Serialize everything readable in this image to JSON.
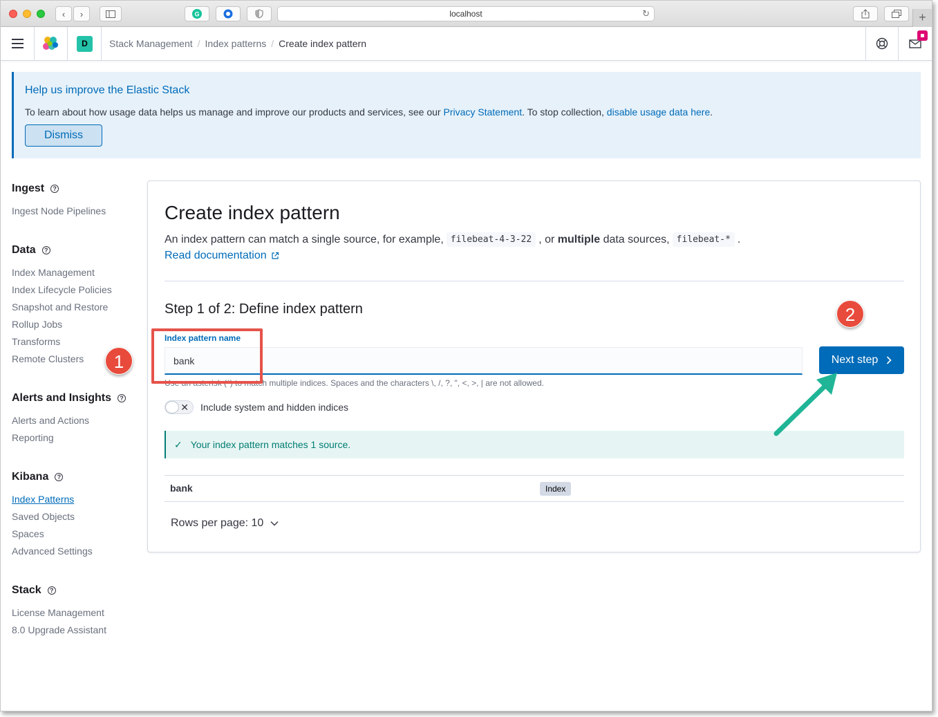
{
  "browser": {
    "url": "localhost"
  },
  "header": {
    "space_initial": "D",
    "breadcrumbs": [
      "Stack Management",
      "Index patterns",
      "Create index pattern"
    ]
  },
  "callout": {
    "title": "Help us improve the Elastic Stack",
    "text_before": "To learn about how usage data helps us manage and improve our products and services, see our ",
    "link1": "Privacy Statement",
    "text_mid": ". To stop collection, ",
    "link2": "disable usage data here",
    "text_after": ".",
    "dismiss_label": "Dismiss"
  },
  "sidenav": {
    "sections": [
      {
        "title": "Ingest",
        "items": [
          "Ingest Node Pipelines"
        ]
      },
      {
        "title": "Data",
        "items": [
          "Index Management",
          "Index Lifecycle Policies",
          "Snapshot and Restore",
          "Rollup Jobs",
          "Transforms",
          "Remote Clusters"
        ]
      },
      {
        "title": "Alerts and Insights",
        "items": [
          "Alerts and Actions",
          "Reporting"
        ]
      },
      {
        "title": "Kibana",
        "items": [
          "Index Patterns",
          "Saved Objects",
          "Spaces",
          "Advanced Settings"
        ]
      },
      {
        "title": "Stack",
        "items": [
          "License Management",
          "8.0 Upgrade Assistant"
        ]
      }
    ],
    "active_item": "Index Patterns"
  },
  "panel": {
    "title": "Create index pattern",
    "desc_1": "An index pattern can match a single source, for example,",
    "code_1": "filebeat-4-3-22",
    "desc_2": ", or",
    "desc_bold": "multiple",
    "desc_3": "data sources,",
    "code_2": "filebeat-*",
    "desc_4": ".",
    "read_doc": "Read documentation",
    "step": "Step 1 of 2: Define index pattern",
    "field_label": "Index pattern name",
    "field_value": "bank",
    "field_help": "Use an asterisk (*) to match multiple indices. Spaces and the characters \\, /, ?, \", <, >, | are not allowed.",
    "toggle_label": "Include system and hidden indices",
    "success_text": "Your index pattern matches 1 source.",
    "table_row_name": "bank",
    "table_row_badge": "Index",
    "rows_per_page": "Rows per page: 10",
    "next_label": "Next step"
  },
  "annotations": {
    "num1": "1",
    "num2": "2"
  },
  "colors": {
    "primary": "#006bb8",
    "success": "#017d73",
    "annotation_red": "#e84b3c",
    "annotation_arrow": "#1fb596"
  }
}
